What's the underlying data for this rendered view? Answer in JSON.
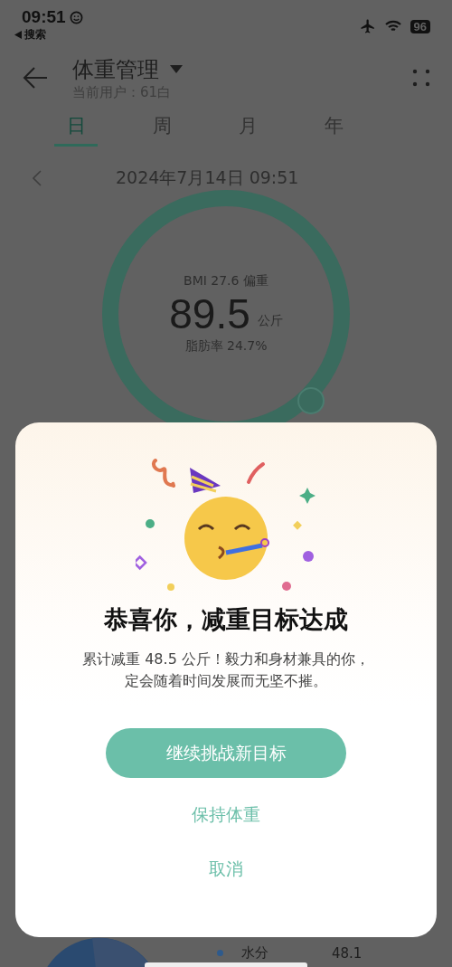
{
  "status_bar": {
    "time": "09:51",
    "back_link": "搜索",
    "battery": "96"
  },
  "header": {
    "title": "体重管理",
    "subtitle": "当前用户：61白"
  },
  "tabs": [
    {
      "label": "日",
      "selected": true
    },
    {
      "label": "周",
      "selected": false
    },
    {
      "label": "月",
      "selected": false
    },
    {
      "label": "年",
      "selected": false
    }
  ],
  "date": "2024年7月14日 09:51",
  "gauge": {
    "bmi": "BMI 27.6 偏重",
    "weight": "89.5",
    "unit": "公斤",
    "body_fat": "脂肪率 24.7%"
  },
  "composition": {
    "legend": [
      {
        "label": "水分",
        "value": "48.1",
        "color": "#2e5a8c"
      }
    ]
  },
  "dialog": {
    "title": "恭喜你，减重目标达成",
    "message": "累计减重 48.5 公斤！毅力和身材兼具的你，定会随着时间发展而无坚不摧。",
    "buttons": [
      {
        "label": "继续挑战新目标",
        "kind": "primary"
      },
      {
        "label": "保持体重",
        "kind": "text"
      },
      {
        "label": "取消",
        "kind": "text"
      }
    ]
  }
}
